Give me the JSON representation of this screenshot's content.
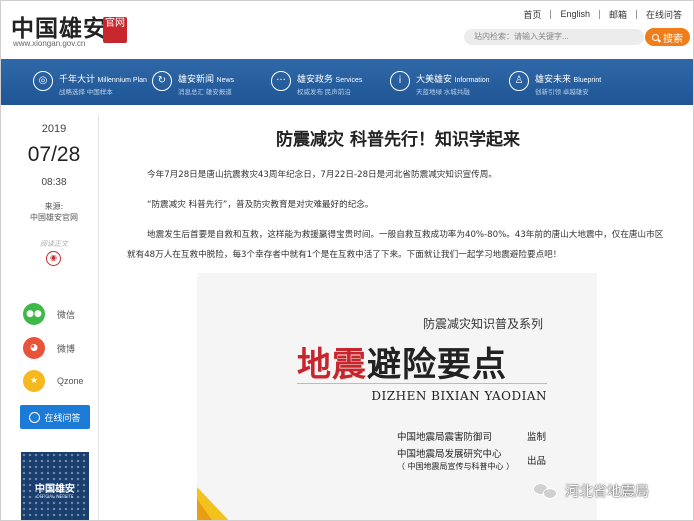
{
  "header": {
    "logo_text": "中国雄安",
    "logo_seal": "官网",
    "logo_url": "www.xiongan.gov.cn",
    "top_links": [
      "首页",
      "English",
      "邮箱",
      "在线问答"
    ],
    "search_placeholder": "站内检索：请输入关键字...",
    "search_button": "搜索"
  },
  "nav": {
    "items": [
      {
        "title": "千年大计",
        "en": "Millennium Plan",
        "sub": "战略选择 中国样本",
        "icon": "target-icon"
      },
      {
        "title": "雄安新闻",
        "en": "News",
        "sub": "消息总汇 雄安报道",
        "icon": "news-icon"
      },
      {
        "title": "雄安政务",
        "en": "Services",
        "sub": "权威发布 民声前沿",
        "icon": "chat-icon"
      },
      {
        "title": "大美雄安",
        "en": "Information",
        "sub": "天蓝地绿 水城共融",
        "icon": "info-icon"
      },
      {
        "title": "雄安未来",
        "en": "Blueprint",
        "sub": "创新引领 卓越雄安",
        "icon": "person-icon"
      }
    ]
  },
  "sidebar": {
    "year": "2019",
    "month_day": "07/28",
    "time": "08:38",
    "source_label": "来源:",
    "source_value": "中国雄安官网",
    "read_label": "阅读正文",
    "share": [
      {
        "label": "微信",
        "icon": "wechat-icon",
        "color": "#3db94a"
      },
      {
        "label": "微博",
        "icon": "weibo-icon",
        "color": "#e8533a"
      },
      {
        "label": "Qzone",
        "icon": "qzone-icon",
        "color": "#f5b91f"
      }
    ],
    "online_qa": "在线问答",
    "qr_logo": "中国雄安",
    "qr_sub": "OFFICIAL WEBSITE"
  },
  "article": {
    "title": "防震减灾 科普先行！知识学起来",
    "p1": "今年7月28日是唐山抗震救灾43周年纪念日，7月22日-28日是河北省防震减灾知识宣传周。",
    "p2": "“防震减灾 科普先行”，普及防灾教育是对灾难最好的纪念。",
    "p3": "地震发生后首要是自救和互救，这样能为救援赢得宝贵时间。一般自救互救成功率为40%-80%。43年前的唐山大地震中，仅在唐山市区就有48万人在互救中脱险，每3个幸存者中就有1个是在互救中活了下来。下面就让我们一起学习地震避险要点吧！"
  },
  "poster": {
    "series": "防震减灾知识普及系列",
    "main_red": "地震",
    "main_black": "避险要点",
    "pinyin": "DIZHEN BIXIAN YAODIAN",
    "org1": "中国地震局震害防御司",
    "role1": "监制",
    "org2": "中国地震局发展研究中心",
    "org3": "（ 中国地震局宣传与科普中心 ）",
    "role2": "出品"
  },
  "watermark": {
    "text": "河北省地震局"
  }
}
